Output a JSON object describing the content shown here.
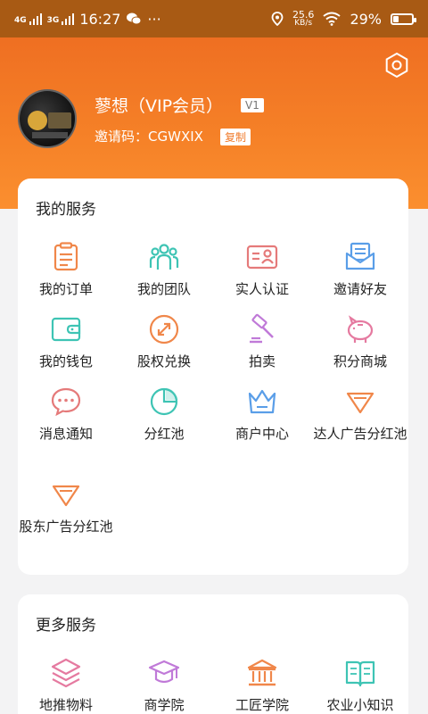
{
  "status_bar": {
    "network1": "4G",
    "network2": "3G",
    "time": "16:27",
    "more": "···",
    "speed_value": "25.6",
    "speed_unit": "KB/s",
    "battery": "29%",
    "battery_level": 0.29
  },
  "profile": {
    "name": "蓼想（VIP会员）",
    "level": "V1",
    "invite_label": "邀请码：",
    "invite_code": "CGWXIX",
    "copy_label": "复制"
  },
  "services": {
    "title": "我的服务",
    "items": [
      {
        "label": "我的订单",
        "icon": "order-icon"
      },
      {
        "label": "我的团队",
        "icon": "team-icon"
      },
      {
        "label": "实人认证",
        "icon": "id-card-icon"
      },
      {
        "label": "邀请好友",
        "icon": "invite-mail-icon"
      },
      {
        "label": "我的钱包",
        "icon": "wallet-icon"
      },
      {
        "label": "股权兑换",
        "icon": "exchange-icon"
      },
      {
        "label": "拍卖",
        "icon": "auction-hammer-icon"
      },
      {
        "label": "积分商城",
        "icon": "piggy-bank-icon"
      },
      {
        "label": "消息通知",
        "icon": "message-icon"
      },
      {
        "label": "分红池",
        "icon": "pie-chart-icon"
      },
      {
        "label": "商户中心",
        "icon": "crown-icon"
      },
      {
        "label": "达人广告分红池",
        "icon": "diamond-icon"
      },
      {
        "label": "股东广告分红池",
        "icon": "diamond-icon"
      }
    ]
  },
  "more_services": {
    "title": "更多服务",
    "items": [
      {
        "label": "地推物料",
        "icon": "layers-icon"
      },
      {
        "label": "商学院",
        "icon": "graduation-cap-icon"
      },
      {
        "label": "工匠学院",
        "icon": "institution-icon"
      },
      {
        "label": "农业小知识",
        "icon": "book-icon"
      }
    ]
  },
  "colors": {
    "header": "#f58027",
    "status_bar": "#a85a14",
    "orange_icon": "#f0874a",
    "teal_icon": "#3ec4b4",
    "pink_icon": "#e57aa0",
    "purple_icon": "#c07ad8",
    "blue_icon": "#5a9ee8"
  }
}
